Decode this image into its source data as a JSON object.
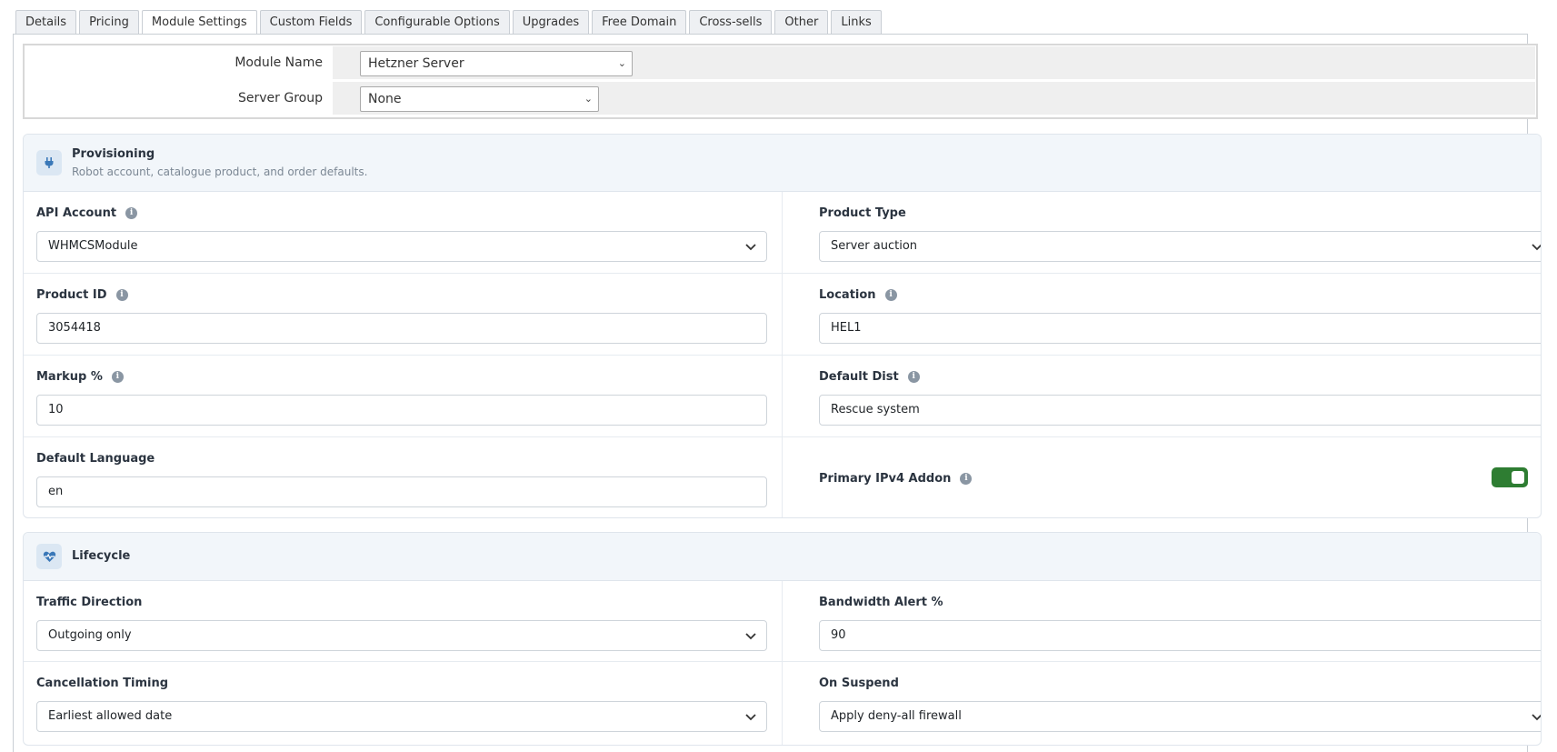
{
  "tabs": [
    {
      "label": "Details"
    },
    {
      "label": "Pricing"
    },
    {
      "label": "Module Settings",
      "active": true
    },
    {
      "label": "Custom Fields"
    },
    {
      "label": "Configurable Options"
    },
    {
      "label": "Upgrades"
    },
    {
      "label": "Free Domain"
    },
    {
      "label": "Cross-sells"
    },
    {
      "label": "Other"
    },
    {
      "label": "Links"
    }
  ],
  "module": {
    "module_name_label": "Module Name",
    "module_name_value": "Hetzner Server",
    "server_group_label": "Server Group",
    "server_group_value": "None"
  },
  "provisioning": {
    "title": "Provisioning",
    "subtitle": "Robot account, catalogue product, and order defaults.",
    "icon": "plug-icon",
    "api_account_label": "API Account",
    "api_account_value": "WHMCSModule",
    "product_type_label": "Product Type",
    "product_type_value": "Server auction",
    "product_id_label": "Product ID",
    "product_id_value": "3054418",
    "location_label": "Location",
    "location_value": "HEL1",
    "markup_label": "Markup %",
    "markup_value": "10",
    "default_dist_label": "Default Dist",
    "default_dist_value": "Rescue system",
    "default_language_label": "Default Language",
    "default_language_value": "en",
    "primary_ipv4_label": "Primary IPv4 Addon",
    "primary_ipv4_enabled": true
  },
  "lifecycle": {
    "title": "Lifecycle",
    "icon": "heartbeat-icon",
    "traffic_direction_label": "Traffic Direction",
    "traffic_direction_value": "Outgoing only",
    "bandwidth_alert_label": "Bandwidth Alert %",
    "bandwidth_alert_value": "90",
    "cancellation_timing_label": "Cancellation Timing",
    "cancellation_timing_value": "Earliest allowed date",
    "on_suspend_label": "On Suspend",
    "on_suspend_value": "Apply deny-all firewall"
  },
  "colors": {
    "toggle_on": "#2e7d32",
    "accent_blue": "#3a78b8"
  }
}
